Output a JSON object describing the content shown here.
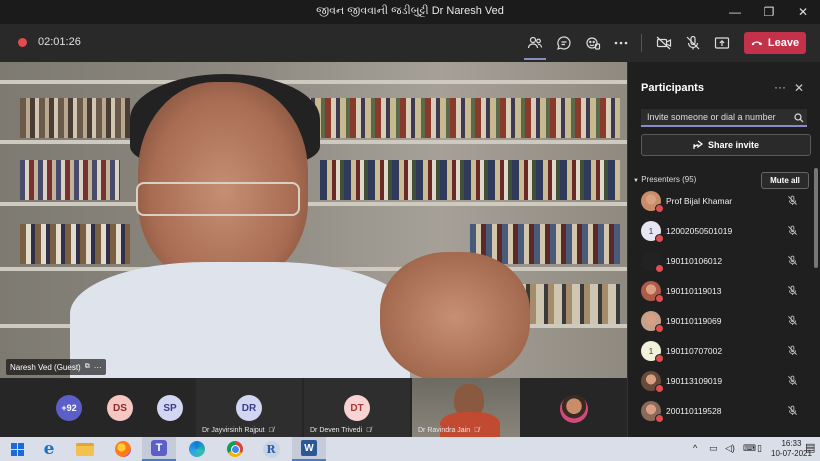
{
  "window": {
    "title": "જીવન જીવવાની જડીબુટ્ટી Dr Naresh Ved",
    "minimize": "—",
    "maximize": "❐",
    "close": "✕"
  },
  "toolbar": {
    "timer": "02:01:26",
    "leave_label": "Leave",
    "icons": [
      "participants-icon",
      "chat-icon",
      "reactions-icon",
      "more-icon",
      "camera-off-icon",
      "mic-off-icon",
      "share-tray-icon"
    ]
  },
  "main_video": {
    "name_tag": "Naresh Ved (Guest)"
  },
  "gallery": {
    "more_count": "+92",
    "avatars": [
      {
        "initials": "DS",
        "color": "#f4c7c3",
        "text_color": "#8a2b2b"
      },
      {
        "initials": "SP",
        "color": "#d3d6f0",
        "text_color": "#3a3f8a"
      }
    ],
    "tiles": [
      {
        "initials": "DR",
        "name": "Dr Jayvirsinh Rajput",
        "color": "#d3d6f0",
        "text_color": "#3a3f8a"
      },
      {
        "initials": "DT",
        "name": "Dr Deven Trivedi",
        "color": "#f7d3d3",
        "text_color": "#a33b3b"
      }
    ],
    "camera_tile_name": "Dr Ravindra Jain"
  },
  "panel": {
    "title": "Participants",
    "invite_placeholder": "Invite someone or dial a number",
    "share_invite": "Share invite",
    "presenters_label": "Presenters (95)",
    "mute_all": "Mute all",
    "participants": [
      {
        "name": "Prof Bijal Khamar",
        "avatar": "photo",
        "color": "#c98d6a"
      },
      {
        "name": "12002050501019",
        "avatar": "1",
        "color": "#e6e6f3"
      },
      {
        "name": "190110106012",
        "avatar": "dark",
        "color": "#222222"
      },
      {
        "name": "190110119013",
        "avatar": "photo",
        "color": "#b05a4a"
      },
      {
        "name": "190110119069",
        "avatar": "photo",
        "color": "#c7a08a"
      },
      {
        "name": "190110707002",
        "avatar": "1",
        "color": "#f1f1dc"
      },
      {
        "name": "190113109019",
        "avatar": "photo",
        "color": "#6a4a3a"
      },
      {
        "name": "200110119528",
        "avatar": "photo",
        "color": "#8a6a5a"
      }
    ]
  },
  "taskbar": {
    "icons": [
      "windows-start-icon",
      "edge-legacy-icon",
      "file-explorer-icon",
      "firefox-icon",
      "teams-icon",
      "edge-icon",
      "chrome-icon",
      "r-icon",
      "word-icon"
    ],
    "clock_time": "16:33",
    "clock_date": "10-07-2021"
  }
}
